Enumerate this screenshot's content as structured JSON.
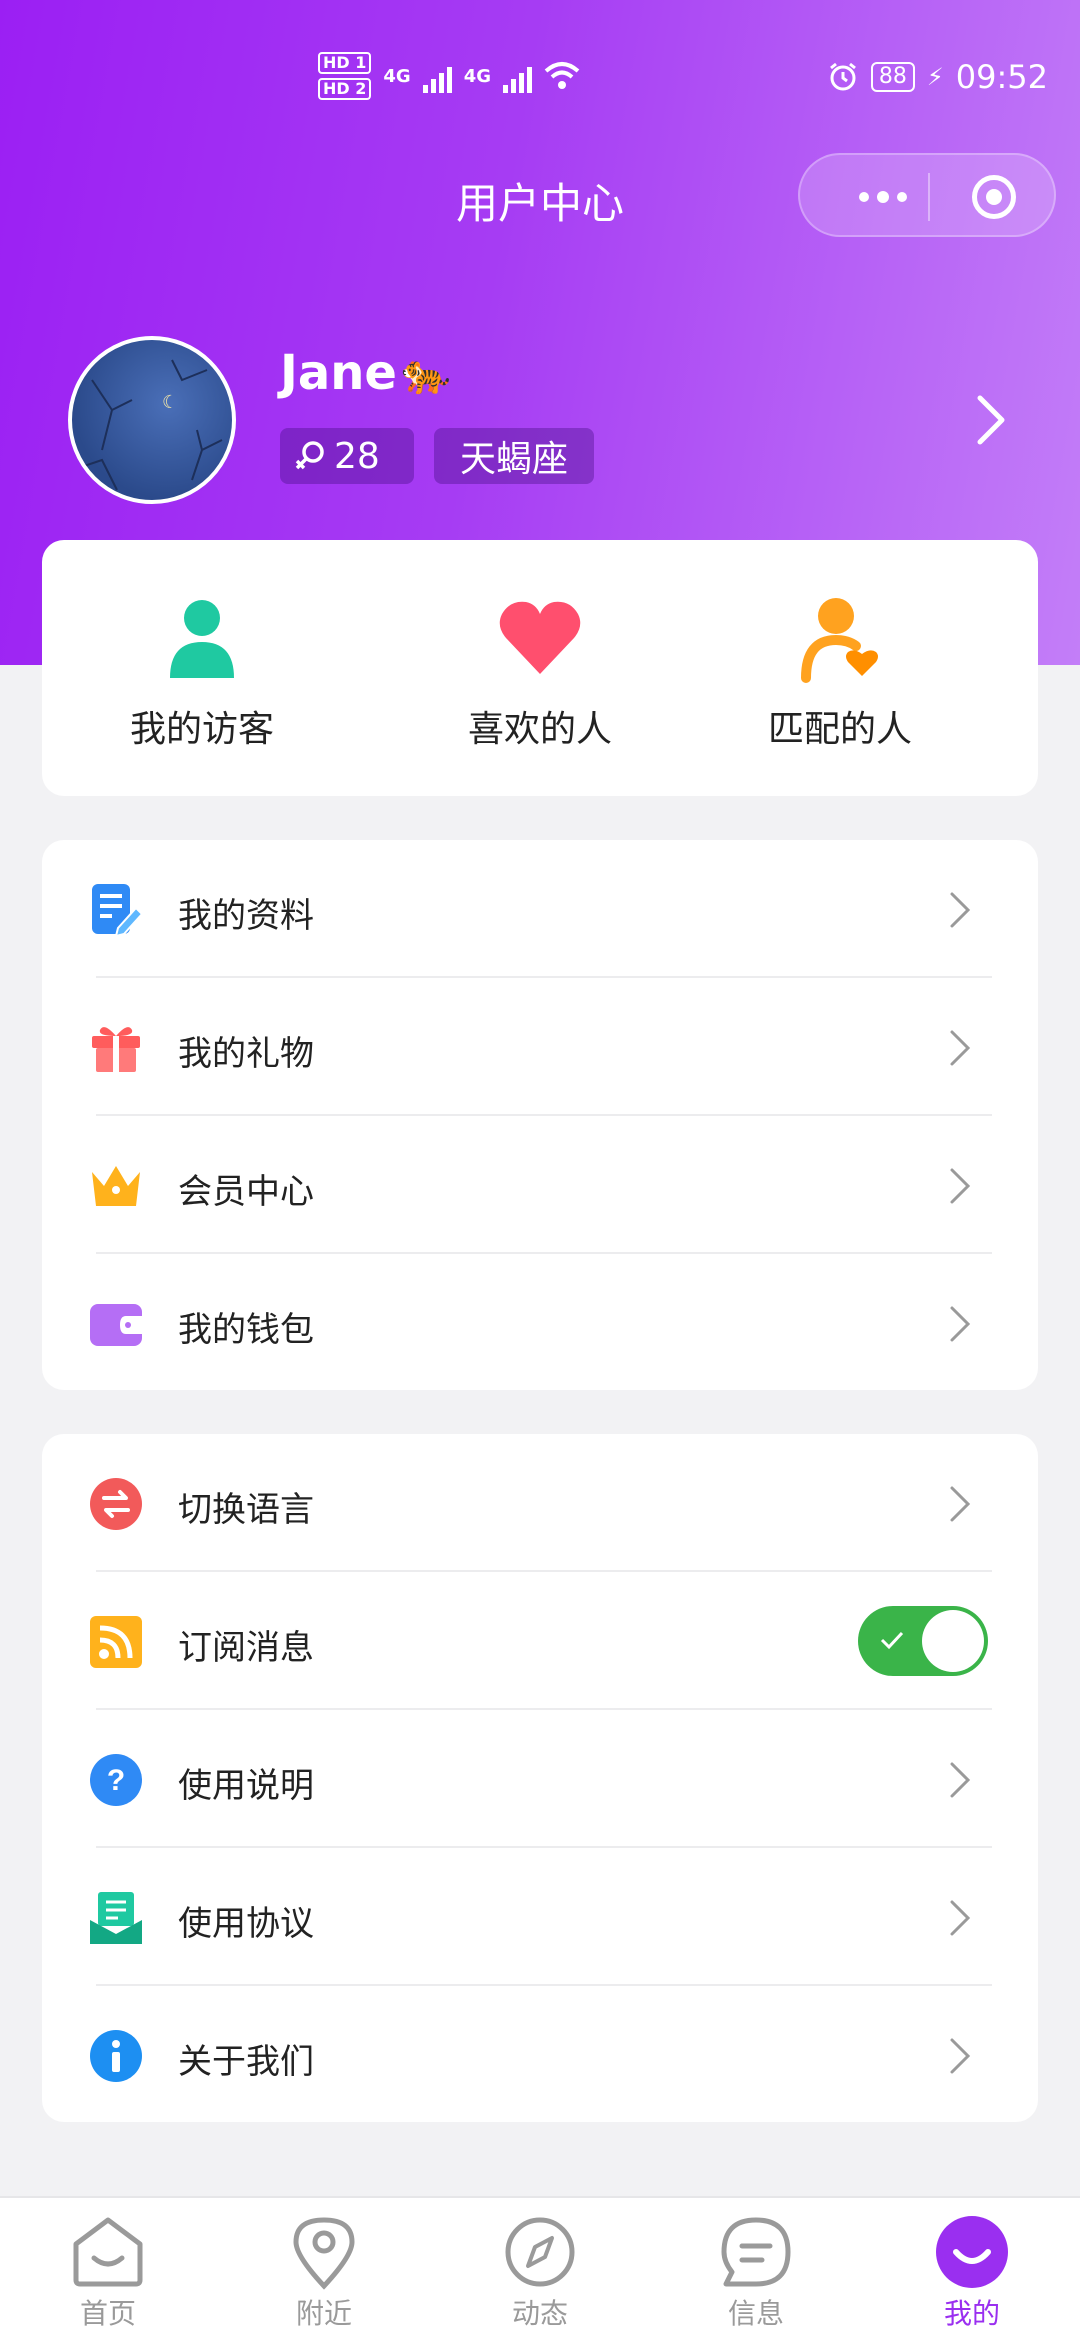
{
  "status_bar": {
    "hd1": "HD 1",
    "hd2": "HD 2",
    "net1": "4G",
    "net2": "4G",
    "battery": "88",
    "time": "09:52"
  },
  "nav": {
    "title": "用户中心"
  },
  "profile": {
    "name": "Jane",
    "age": "28",
    "zodiac": "天蝎座"
  },
  "quick_actions": [
    {
      "label": "我的访客",
      "icon": "visitor-icon",
      "color": "#1fc9a1"
    },
    {
      "label": "喜欢的人",
      "icon": "heart-icon",
      "color": "#ff4f6e"
    },
    {
      "label": "匹配的人",
      "icon": "match-icon",
      "color": "#ffa21f"
    }
  ],
  "menu_group_1": [
    {
      "label": "我的资料",
      "icon": "profile-doc-icon"
    },
    {
      "label": "我的礼物",
      "icon": "gift-icon"
    },
    {
      "label": "会员中心",
      "icon": "crown-icon"
    },
    {
      "label": "我的钱包",
      "icon": "wallet-icon"
    }
  ],
  "menu_group_2": [
    {
      "label": "切换语言",
      "icon": "language-switch-icon"
    },
    {
      "label": "订阅消息",
      "icon": "rss-icon",
      "toggle_on": true
    },
    {
      "label": "使用说明",
      "icon": "help-icon"
    },
    {
      "label": "使用协议",
      "icon": "agreement-icon"
    },
    {
      "label": "关于我们",
      "icon": "info-icon"
    }
  ],
  "tabs": [
    {
      "label": "首页",
      "icon": "home-icon"
    },
    {
      "label": "附近",
      "icon": "location-icon"
    },
    {
      "label": "动态",
      "icon": "compass-icon"
    },
    {
      "label": "信息",
      "icon": "message-icon"
    },
    {
      "label": "我的",
      "icon": "me-icon",
      "active": true
    }
  ],
  "colors": {
    "header_gradient_start": "#9b1ff3",
    "header_gradient_end": "#c37ef8",
    "accent": "#9a2ff0",
    "toggle_on": "#3ab449"
  }
}
